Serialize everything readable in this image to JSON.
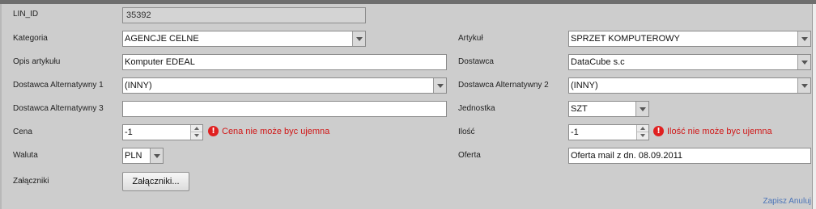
{
  "colors": {
    "error": "#d01818",
    "link": "#4a74b8",
    "panel": "#cdcdcd"
  },
  "icons": {
    "error": "exclamation-circle-icon",
    "dropdown": "chevron-down-icon",
    "spinner": "up-down-arrows-icon"
  },
  "form": {
    "lin_id": {
      "label": "LIN_ID",
      "value": "35392"
    },
    "kategoria": {
      "label": "Kategoria",
      "value": "AGENCJE CELNE"
    },
    "artykul": {
      "label": "Artykuł",
      "value": "SPRZET KOMPUTEROWY"
    },
    "opis": {
      "label": "Opis artykułu",
      "value": "Komputer EDEAL"
    },
    "dostawca": {
      "label": "Dostawca",
      "value": "DataCube s.c"
    },
    "dostawca_alt1": {
      "label": "Dostawca Alternatywny 1",
      "value": "(INNY)"
    },
    "dostawca_alt2": {
      "label": "Dostawca Alternatywny 2",
      "value": "(INNY)"
    },
    "dostawca_alt3": {
      "label": "Dostawca Alternatywny 3",
      "value": ""
    },
    "jednostka": {
      "label": "Jednostka",
      "value": "SZT"
    },
    "cena": {
      "label": "Cena",
      "value": "-1",
      "error": "Cena nie może byc ujemna"
    },
    "ilosc": {
      "label": "Ilość",
      "value": "-1",
      "error": "Ilość nie może byc ujemna"
    },
    "waluta": {
      "label": "Waluta",
      "value": "PLN"
    },
    "oferta": {
      "label": "Oferta",
      "value": "Oferta mail z dn. 08.09.2011"
    },
    "zalaczniki": {
      "label": "Załączniki",
      "button": "Załączniki..."
    }
  },
  "footer": {
    "save": "Zapisz",
    "cancel": "Anuluj"
  }
}
